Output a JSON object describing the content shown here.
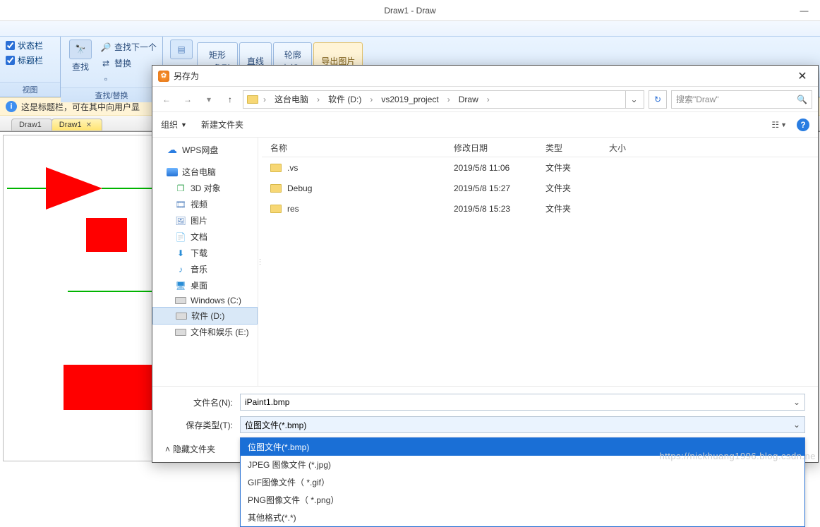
{
  "title": "Draw1 - Draw",
  "ribbon": {
    "view": {
      "label": "视图",
      "status_cb": "状态栏",
      "title_cb": "标题栏"
    },
    "search": {
      "label": "查找/替换",
      "find_next": "查找下一个",
      "find": "查找",
      "replace": "替换"
    },
    "tabs": {
      "rect": {
        "l1": "矩形",
        "l2": "三角形"
      },
      "line": {
        "l1": "直线",
        "l2": ""
      },
      "outline": {
        "l1": "轮廓",
        "l2": "内部 ▾"
      },
      "export": {
        "l1": "导出图片",
        "l2": ""
      }
    }
  },
  "info_bar": "这是标题栏，可在其中向用户显",
  "doc_tabs": [
    {
      "label": "Draw1",
      "active": false
    },
    {
      "label": "Draw1",
      "active": true
    }
  ],
  "dialog": {
    "title": "另存为",
    "crumbs": [
      "这台电脑",
      "软件 (D:)",
      "vs2019_project",
      "Draw"
    ],
    "search_ph": "搜索\"Draw\"",
    "tb": {
      "org": "组织",
      "newfolder": "新建文件夹"
    },
    "tree": [
      {
        "icon": "cloud",
        "label": "WPS网盘"
      },
      {
        "icon": "pc",
        "label": "这台电脑"
      },
      {
        "icon": "cube",
        "label": "3D 对象"
      },
      {
        "icon": "video",
        "label": "视频"
      },
      {
        "icon": "image",
        "label": "图片"
      },
      {
        "icon": "doc",
        "label": "文档"
      },
      {
        "icon": "down",
        "label": "下载"
      },
      {
        "icon": "music",
        "label": "音乐"
      },
      {
        "icon": "desk",
        "label": "桌面"
      },
      {
        "icon": "drive",
        "label": "Windows (C:)"
      },
      {
        "icon": "drive",
        "label": "软件 (D:)",
        "sel": true
      },
      {
        "icon": "drive",
        "label": "文件和娱乐 (E:)"
      }
    ],
    "columns": {
      "name": "名称",
      "date": "修改日期",
      "type": "类型",
      "size": "大小"
    },
    "rows": [
      {
        "name": ".vs",
        "date": "2019/5/8 11:06",
        "type": "文件夹"
      },
      {
        "name": "Debug",
        "date": "2019/5/8 15:27",
        "type": "文件夹"
      },
      {
        "name": "res",
        "date": "2019/5/8 15:23",
        "type": "文件夹"
      }
    ],
    "filename_label": "文件名(N):",
    "filename_value": "iPaint1.bmp",
    "type_label": "保存类型(T):",
    "type_value": "位图文件(*.bmp)",
    "hide_folders": "隐藏文件夹",
    "dd_options": [
      "位图文件(*.bmp)",
      "JPEG 图像文件 (*.jpg)",
      " GIF图像文件（ *.gif）",
      " PNG图像文件（ *.png）",
      "其他格式(*.*)"
    ]
  },
  "watermark": "https://nickhuang1996.blog.csdn.ne"
}
